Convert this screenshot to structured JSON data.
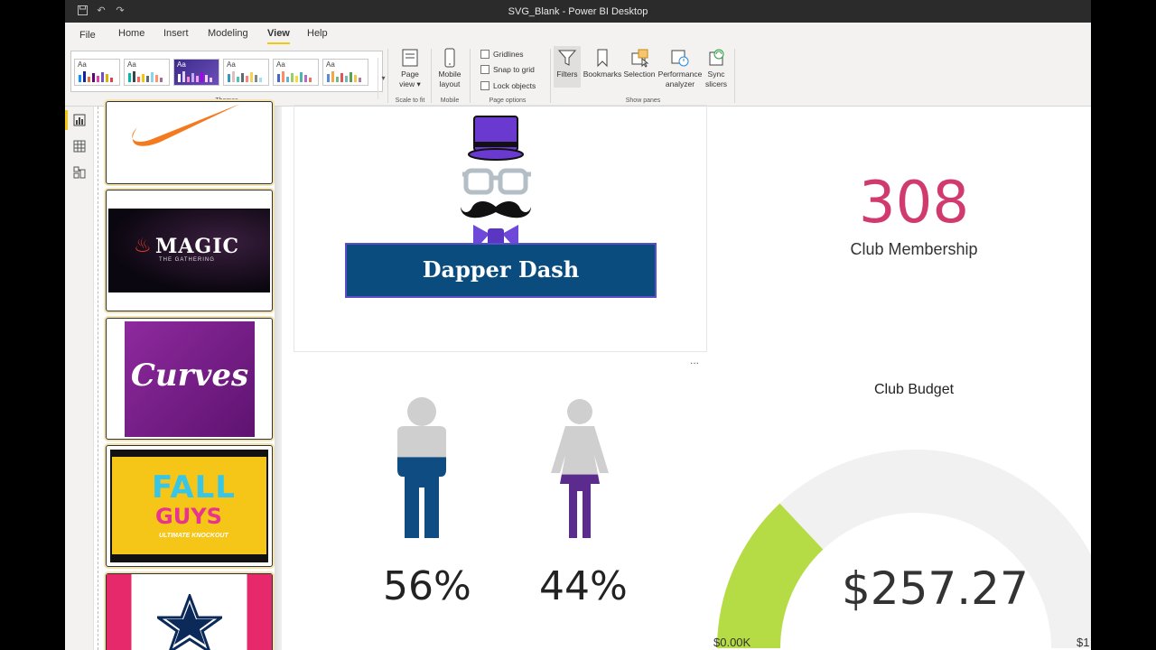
{
  "window": {
    "title": "SVG_Blank - Power BI Desktop"
  },
  "ribbon_tabs": [
    "File",
    "Home",
    "Insert",
    "Modeling",
    "View",
    "Help"
  ],
  "active_tab": "View",
  "ribbon": {
    "themes_label": "Themes",
    "theme_aa": "Aa",
    "scale_label": "Scale to fit",
    "page_view": "Page view",
    "mobile_label": "Mobile",
    "mobile_layout": "Mobile layout",
    "page_options_label": "Page options",
    "gridlines": "Gridlines",
    "snap_to_grid": "Snap to grid",
    "lock_objects": "Lock objects",
    "show_panes_label": "Show panes",
    "filters": "Filters",
    "bookmarks": "Bookmarks",
    "selection": "Selection",
    "performance_analyzer": "Performance analyzer",
    "sync_slicers": "Sync slicers"
  },
  "thumbnails": [
    {
      "name": "nike",
      "label": ""
    },
    {
      "name": "magic",
      "label": "MAGIC",
      "sublabel": "THE GATHERING"
    },
    {
      "name": "curves",
      "label": "Curves"
    },
    {
      "name": "fall-guys",
      "label": "FALL",
      "label2": "GUYS",
      "sublabel": "ULTIMATE KNOCKOUT"
    },
    {
      "name": "cowboys",
      "label": ""
    }
  ],
  "logo": {
    "text": "Dapper Dash"
  },
  "membership_card": {
    "value": "308",
    "label": "Club Membership"
  },
  "gender": {
    "male_pct": "56%",
    "female_pct": "44%",
    "male_fraction": 0.56,
    "female_fraction": 0.44
  },
  "budget": {
    "title": "Club Budget",
    "value": "$257.27",
    "min": "$0.00K",
    "max": "$1",
    "fill_fraction": 0.26
  },
  "visual_menu": "...",
  "colors": {
    "accent": "#f2c811",
    "card_number": "#d13a6e",
    "male": "#0f4c81",
    "female": "#5b2c8e",
    "gauge_fill": "#b5dc45",
    "gauge_track": "#f2f1f1",
    "logo_banner": "#0a4c7e"
  }
}
